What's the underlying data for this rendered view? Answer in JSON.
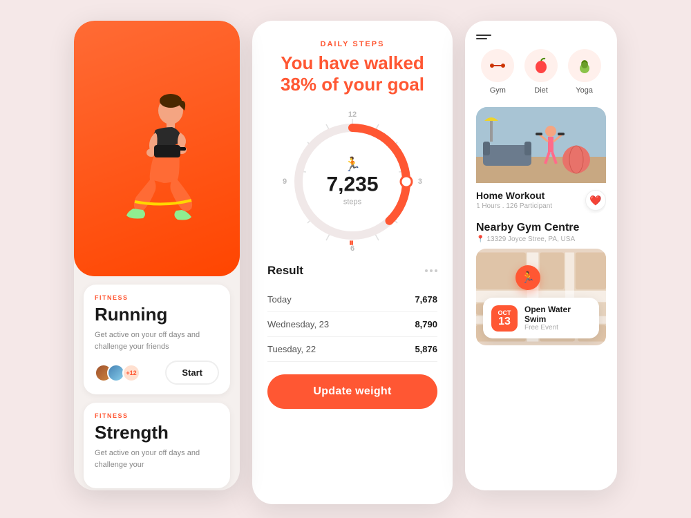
{
  "panel1": {
    "fitness_label1": "FITNESS",
    "title1": "Running",
    "desc1": "Get active on your off days and challenge your friends",
    "avatar_count": "+12",
    "start_btn": "Start",
    "fitness_label2": "FITNESS",
    "title2": "Strength",
    "desc2": "Get active on your off days and challenge your"
  },
  "panel2": {
    "daily_steps_label": "DAILY STEPS",
    "headline_part1": "You have walked",
    "headline_percent": "38%",
    "headline_part2": "of your goal",
    "steps_value": "7,235",
    "steps_label": "steps",
    "clock_12": "12",
    "clock_9": "9",
    "clock_3": "3",
    "clock_6": "6",
    "result_title": "Result",
    "row1_day": "Today",
    "row1_value": "7,678",
    "row2_day": "Wednesday, 23",
    "row2_value": "8,790",
    "row3_day": "Tuesday, 22",
    "row3_value": "5,876",
    "update_btn": "Update weight"
  },
  "panel3": {
    "category1_label": "Gym",
    "category2_label": "Diet",
    "category3_label": "Yoga",
    "category1_emoji": "🏋️",
    "category2_emoji": "🍎",
    "category3_emoji": "🏺",
    "workout_name": "Home Workout",
    "workout_meta": "1 Hours . 126 Participant",
    "nearby_title": "Nearby Gym Centre",
    "nearby_address": "13329 Joyce Stree, PA, USA",
    "event_month": "OCT",
    "event_day": "13",
    "event_title": "Open Water Swim",
    "event_subtitle": "Free Event"
  }
}
